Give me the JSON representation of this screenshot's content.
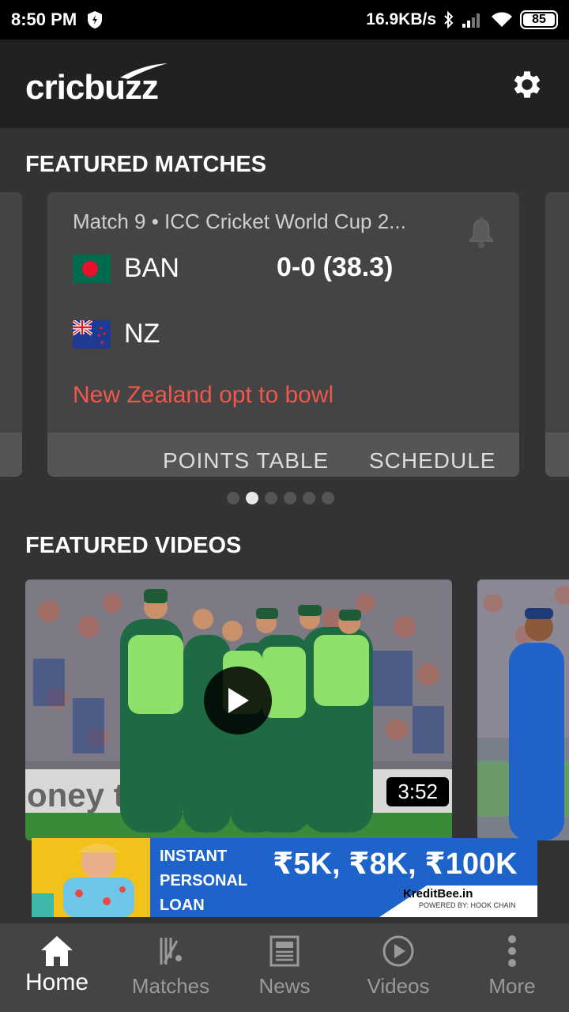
{
  "status_bar": {
    "time": "8:50 PM",
    "network_speed": "16.9KB/s",
    "battery": "85"
  },
  "header": {
    "logo": "cricbuzz"
  },
  "featured_matches": {
    "title": "FEATURED MATCHES",
    "match": {
      "title": "Match 9 • ICC Cricket World Cup 2...",
      "team1": {
        "name": "BAN",
        "score": "0-0 (38.3)"
      },
      "team2": {
        "name": "NZ"
      },
      "status": "New Zealand opt to bowl",
      "actions": [
        "POINTS TABLE",
        "SCHEDULE"
      ]
    },
    "pages": 6,
    "active_page": 2
  },
  "featured_videos": {
    "title": "FEATURED VIDEOS",
    "video1": {
      "duration": "3:52"
    }
  },
  "ad": {
    "left_text": "INSTANT\nPERSONAL\nLOAN",
    "amounts": "₹5K, ₹8K, ₹100K",
    "brand": "KreditBee.in",
    "powered": "POWERED BY: HOOK CHAIN"
  },
  "bottom_nav": {
    "items": [
      {
        "label": "Home",
        "icon": "home-icon",
        "active": true
      },
      {
        "label": "Matches",
        "icon": "cricket-bat-icon",
        "active": false
      },
      {
        "label": "News",
        "icon": "newspaper-icon",
        "active": false
      },
      {
        "label": "Videos",
        "icon": "play-circle-icon",
        "active": false
      },
      {
        "label": "More",
        "icon": "more-vertical-icon",
        "active": false
      }
    ]
  },
  "colors": {
    "background": "#333333",
    "header": "#212121",
    "card": "#444444",
    "status_red": "#f0564c"
  }
}
